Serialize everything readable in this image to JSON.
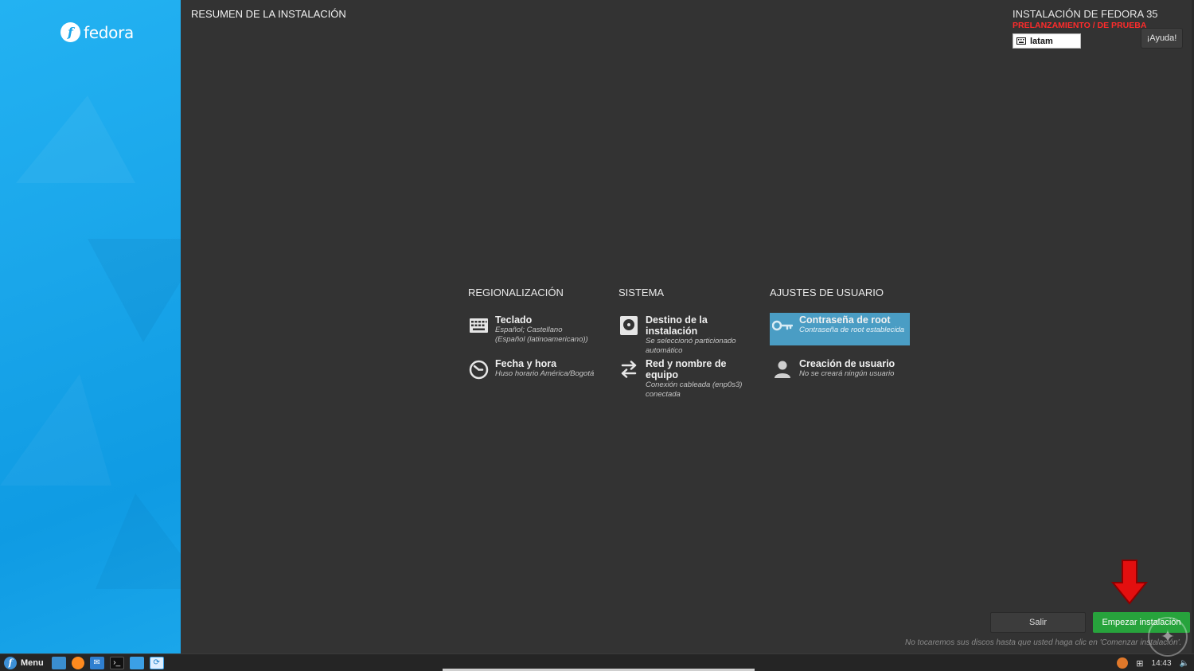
{
  "sidebar": {
    "logo_text": "fedora",
    "logo_mark": "f"
  },
  "header": {
    "title": "RESUMEN DE LA INSTALACIÓN",
    "product": "INSTALACIÓN DE FEDORA 35",
    "prerelease": "PRELANZAMIENTO / DE PRUEBA",
    "keyboard_layout": "latam",
    "help_label": "¡Ayuda!"
  },
  "sections": [
    {
      "title": "REGIONALIZACIÓN",
      "spokes": [
        {
          "icon": "keyboard-icon",
          "title": "Teclado",
          "status": [
            "Español; Castellano",
            "(Español (latinoamericano))"
          ]
        },
        {
          "icon": "clock-icon",
          "title": "Fecha y hora",
          "status": [
            "Huso horario América/Bogotá"
          ]
        }
      ]
    },
    {
      "title": "SISTEMA",
      "spokes": [
        {
          "icon": "disk-icon",
          "title": "Destino de la instalación",
          "status": [
            "Se seleccionó particionado",
            "automático"
          ]
        },
        {
          "icon": "network-arrows-icon",
          "title": "Red y nombre de equipo",
          "status": [
            "Conexión cableada (enp0s3)",
            "conectada"
          ]
        }
      ]
    },
    {
      "title": "AJUSTES DE USUARIO",
      "spokes": [
        {
          "icon": "key-icon",
          "title": "Contraseña de root",
          "status": [
            "Contraseña de root establecida"
          ],
          "selected": true
        },
        {
          "icon": "user-icon",
          "title": "Creación de usuario",
          "status": [
            "No se creará ningún usuario"
          ]
        }
      ]
    }
  ],
  "footer": {
    "quit_label": "Salir",
    "begin_label": "Empezar instalación",
    "warning": "No tocaremos sus discos hasta que usted haga clic en 'Comenzar instalación'."
  },
  "taskbar": {
    "menu_label": "Menu",
    "clock": "14:43"
  },
  "colors": {
    "sidebar": "#1aa6ea",
    "main_bg": "#333333",
    "accent_green": "#27a33c",
    "selected_spoke": "#4a9dc4",
    "prerelease_red": "#ff2b2b"
  }
}
